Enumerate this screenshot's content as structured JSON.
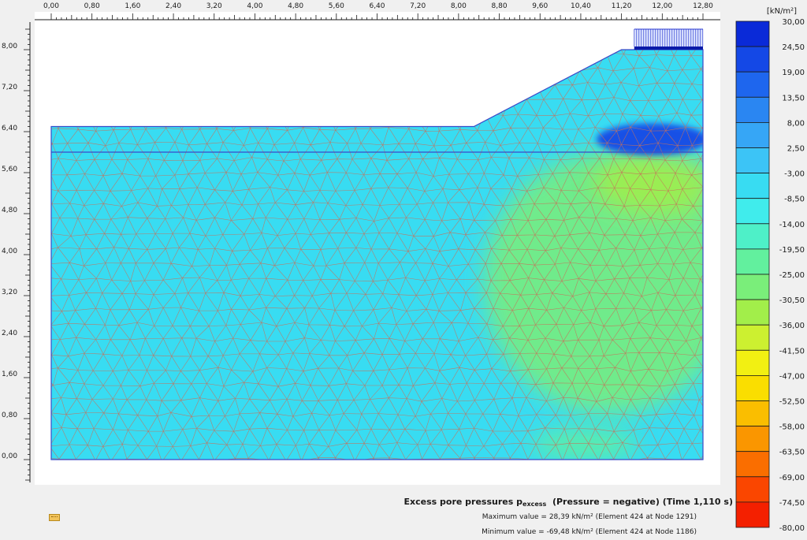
{
  "chart_data": {
    "type": "heatmap",
    "title": "Excess pore pressures",
    "title_sub": "excess",
    "title_symbol": "p",
    "title_suffix": "(Pressure = negative) (Time 1,110 s)",
    "unit": "[kN/m²]",
    "x_ticks": [
      "0,00",
      "0,80",
      "1,60",
      "2,40",
      "3,20",
      "4,00",
      "4,80",
      "5,60",
      "6,40",
      "7,20",
      "8,00",
      "8,80",
      "9,60",
      "10,40",
      "11,20",
      "12,00",
      "12,80"
    ],
    "x_tick_values": [
      0,
      0.8,
      1.6,
      2.4,
      3.2,
      4.0,
      4.8,
      5.6,
      6.4,
      7.2,
      8.0,
      8.8,
      9.6,
      10.4,
      11.2,
      12.0,
      12.8
    ],
    "y_ticks": [
      "8,00",
      "7,20",
      "6,40",
      "5,60",
      "4,80",
      "4,00",
      "3,20",
      "2,40",
      "1,60",
      "0,80",
      "0,00"
    ],
    "y_tick_values": [
      8.0,
      7.2,
      6.4,
      5.6,
      4.8,
      4.0,
      3.2,
      2.4,
      1.6,
      0.8,
      0.0
    ],
    "xlim": [
      0,
      12.8
    ],
    "ylim": [
      0,
      8.0
    ],
    "legend_values": [
      "30,00",
      "24,50",
      "19,00",
      "13,50",
      "8,00",
      "2,50",
      "-3,00",
      "-8,50",
      "-14,00",
      "-19,50",
      "-25,00",
      "-30,50",
      "-36,00",
      "-41,50",
      "-47,00",
      "-52,50",
      "-58,00",
      "-63,50",
      "-69,00",
      "-74,50",
      "-80,00"
    ],
    "legend_colors": [
      "#0a2ad8",
      "#1448e6",
      "#1e66ee",
      "#2a86f2",
      "#36a6f6",
      "#3cc4f6",
      "#38dcf2",
      "#40ecec",
      "#4ef0c8",
      "#62f09e",
      "#7aee7a",
      "#a2ee4a",
      "#ccf030",
      "#f2f012",
      "#fade00",
      "#fabe00",
      "#fa9600",
      "#fa6e00",
      "#fa4600",
      "#f42000",
      "#ee0000"
    ],
    "geometry": {
      "domain_outline": [
        [
          0,
          0
        ],
        [
          12.8,
          0
        ],
        [
          12.8,
          8.0
        ],
        [
          11.2,
          8.0
        ],
        [
          8.3,
          6.5
        ],
        [
          0,
          6.5
        ]
      ],
      "layer_line_y": 6.0,
      "load_x": [
        11.45,
        12.8
      ]
    },
    "result_field": [
      {
        "region": "soil (default)",
        "value": -4.0
      },
      {
        "region": "right zone",
        "x": [
          8.2,
          12.8
        ],
        "y": [
          0.9,
          6.0
        ],
        "value": -26.0
      },
      {
        "region": "right upper core",
        "x": [
          10.6,
          12.8
        ],
        "y": [
          4.8,
          6.0
        ],
        "value": -34.0
      },
      {
        "region": "under load",
        "x": [
          10.8,
          12.8
        ],
        "y": [
          6.0,
          6.5
        ],
        "value": 22.0
      },
      {
        "region": "bottom right",
        "x": [
          9.4,
          11.2
        ],
        "y": [
          0,
          0.6
        ],
        "value": -24.0
      }
    ],
    "max_value": "Maximum value = 28,39 kN/m² (Element 424 at Node 1291)",
    "min_value": "Minimum value = -69,48 kN/m² (Element 424 at Node 1186)"
  },
  "colors": {
    "background": "#f0f0f0",
    "canvas": "#ffffff",
    "outline": "#3a49c8",
    "mesh": "#c8705a"
  }
}
